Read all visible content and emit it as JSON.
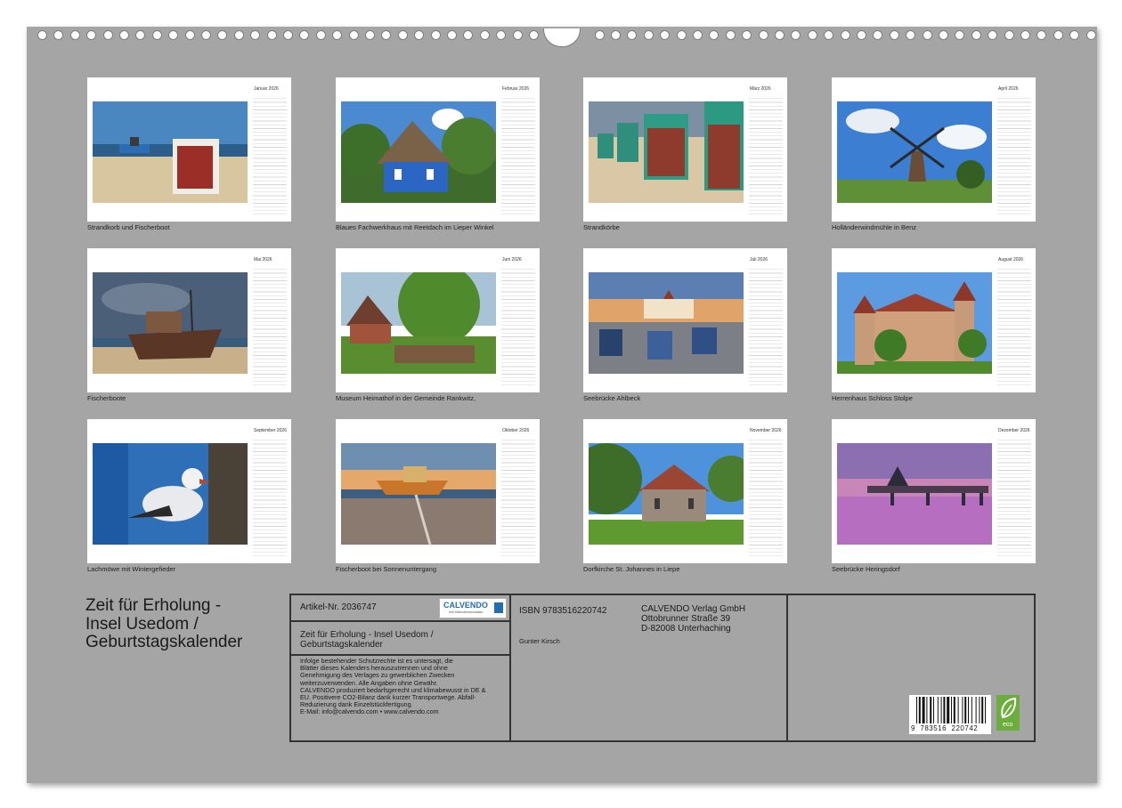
{
  "calendar": {
    "months": [
      {
        "month": "Januar 2026",
        "caption": "Strandkorb und Fischerboot"
      },
      {
        "month": "Februar 2026",
        "caption": "Blaues Fachwerkhaus mit Reetdach im Lieper Winkel"
      },
      {
        "month": "März 2026",
        "caption": "Strandkörbe"
      },
      {
        "month": "April 2026",
        "caption": "Holländerwindmühle in Benz"
      },
      {
        "month": "Mai 2026",
        "caption": "Fischerboote"
      },
      {
        "month": "Juni 2026",
        "caption": "Museum Heimathof in der Gemeinde Rankwitz,"
      },
      {
        "month": "Juli 2026",
        "caption": "Seebrücke Ahlbeck"
      },
      {
        "month": "August 2026",
        "caption": "Herrenhaus Schloss Stolpe"
      },
      {
        "month": "September 2026",
        "caption": "Lachmöwe mit Wintergefieder"
      },
      {
        "month": "Oktober 2026",
        "caption": "Fischerboot bei Sonnenuntergang"
      },
      {
        "month": "November 2026",
        "caption": "Dorfkirche St. Johannes in Liepe"
      },
      {
        "month": "Dezember 2026",
        "caption": "Seebrücke Heringsdorf"
      }
    ]
  },
  "title": {
    "line1": "Zeit für Erholung -",
    "line2": "Insel Usedom /",
    "line3": "Geburtstagskalender"
  },
  "info": {
    "article": "Artikel-Nr. 2036747",
    "logo_text": "CALVENDO",
    "logo_sub": "Ihre Kalendermanufaktur",
    "product_title_1": "Zeit für Erholung - Insel Usedom /",
    "product_title_2": "Geburtstagskalender",
    "legal": [
      "Infolge bestehender Schutzrechte ist es untersagt, die",
      "Blätter dieses Kalenders herauszutrennen und ohne",
      "Genehmigung des Verlages zu gewerblichen Zwecken",
      "weiterzuverwenden. Alle Angaben ohne Gewähr.",
      "CALVENDO produziert bedarfsgerecht und klimabewusst in DE &",
      "EU. Positivere CO2-Bilanz dank kurzer Transportwege. Abfall-",
      "Reduzierung dank Einzelstückfertigung.",
      "E-Mail: info@calvendo.com • www.calvendo.com"
    ],
    "isbn": "ISBN 9783516220742",
    "author": "Gunter Kirsch",
    "publisher_1": "CALVENDO Verlag GmbH",
    "publisher_2": "Ottobrunner Straße 39",
    "publisher_3": "D-82008 Unterhaching",
    "barcode_number": "9  783516  220742",
    "eco_label": "eco"
  },
  "colors": {
    "sheet": "#a5a5a5",
    "eco_green": "#6cae3e",
    "calvendo_blue": "#1f6fb4"
  }
}
